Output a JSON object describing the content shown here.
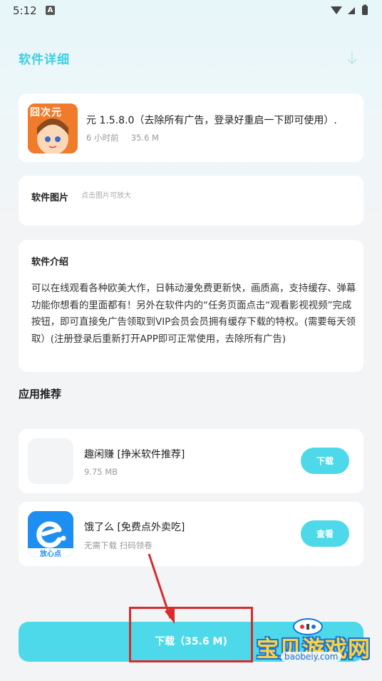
{
  "status_bar": {
    "time": "5:12",
    "notification_badge": "A"
  },
  "header": {
    "title": "软件详细",
    "download_arrow_icon": "arrow-down-icon"
  },
  "app": {
    "title": "元 1.5.8.0（去除所有广告，登录好重启一下即可使用）.",
    "time_ago": "6 小时前",
    "size": "35.6 M",
    "icon_text": "囧次元"
  },
  "screenshots": {
    "label": "软件图片",
    "hint": "点击图片可放大"
  },
  "intro": {
    "label": "软件介绍",
    "text": "可以在线观看各种欧美大作，日韩动漫免费更新快，画质高，支持缓存、弹幕功能你想看的里面都有！另外在软件内的“任务页面点击“观看影视视频”完成按钮，即可直接免广告领取到VIP会员会员拥有缓存下载的特权。(需要每天领取）(注册登录后重新打开APP即可正常使用，去除所有广告)"
  },
  "recommend": {
    "heading": "应用推荐",
    "items": [
      {
        "name": "趣闲赚 [挣米软件推荐]",
        "sub": "9.75 MB",
        "button": "下载"
      },
      {
        "name": "饿了么 [免费点外卖吃]",
        "sub": "无需下载 扫码领卷",
        "button": "查看",
        "icon_text": "放心点"
      }
    ]
  },
  "download_bar": {
    "label": "下载（35.6 M)"
  },
  "watermark": {
    "text": "宝贝游戏网",
    "url": "baobeiy.com"
  },
  "colors": {
    "accent": "#4dd9ea",
    "title": "#3ccfe0",
    "highlight_box": "#d62c2c"
  }
}
